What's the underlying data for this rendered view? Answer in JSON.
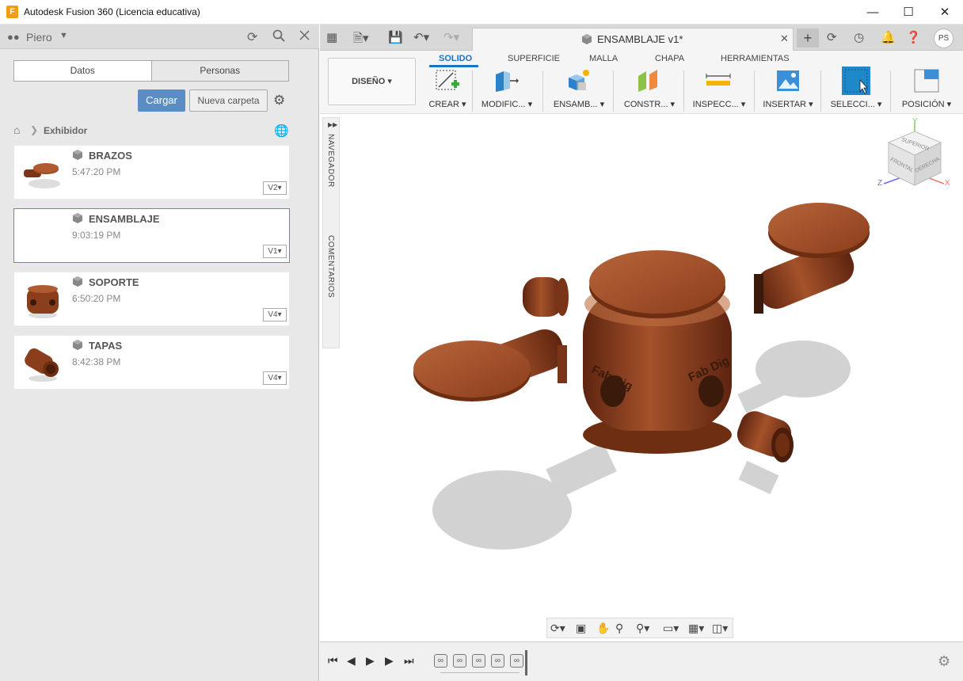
{
  "window": {
    "title": "Autodesk Fusion 360 (Licencia educativa)",
    "app_icon_letter": "F",
    "minimize": "—",
    "maximize": "☐",
    "close": "✕"
  },
  "left_panel": {
    "user": "Piero",
    "tabs": [
      "Datos",
      "Personas"
    ],
    "cargar_label": "Cargar",
    "nueva_carpeta_label": "Nueva carpeta",
    "breadcrumb": "Exhibidor",
    "files": [
      {
        "name": "BRAZOS",
        "time": "5:47:20 PM",
        "version": "V2"
      },
      {
        "name": "ENSAMBLAJE",
        "time": "9:03:19 PM",
        "version": "V1"
      },
      {
        "name": "SOPORTE",
        "time": "6:50:20 PM",
        "version": "V4"
      },
      {
        "name": "TAPAS",
        "time": "8:42:38 PM",
        "version": "V4"
      }
    ]
  },
  "document_tab": {
    "name": "ENSAMBLAJE v1*",
    "close": "✕"
  },
  "user_initials": "PS",
  "ribbon": {
    "workspace": "DISEÑO ▾",
    "tabs": [
      "SOLIDO",
      "SUPERFICIE",
      "MALLA",
      "CHAPA",
      "HERRAMIENTAS"
    ],
    "active_tab": "SOLIDO",
    "tools": [
      "CREAR ▾",
      "MODIFIC... ▾",
      "ENSAMB... ▾",
      "CONSTR... ▾",
      "INSPECC... ▾",
      "INSERTAR ▾",
      "SELECCI... ▾",
      "POSICIÓN ▾"
    ]
  },
  "side_strip": {
    "navegador": "NAVEGADOR",
    "comentarios": "COMENTARIOS"
  },
  "viewcube": {
    "top": "SUPERIOR",
    "front": "FRONTAL",
    "right": "DERECHA",
    "x": "X",
    "y": "Y",
    "z": "Z"
  },
  "model_text": "Fab Dig",
  "colors": {
    "accent": "#1a73c5",
    "button": "#5b8dc4",
    "wood": "#8b3e1c",
    "selection": "#1e88c8"
  }
}
